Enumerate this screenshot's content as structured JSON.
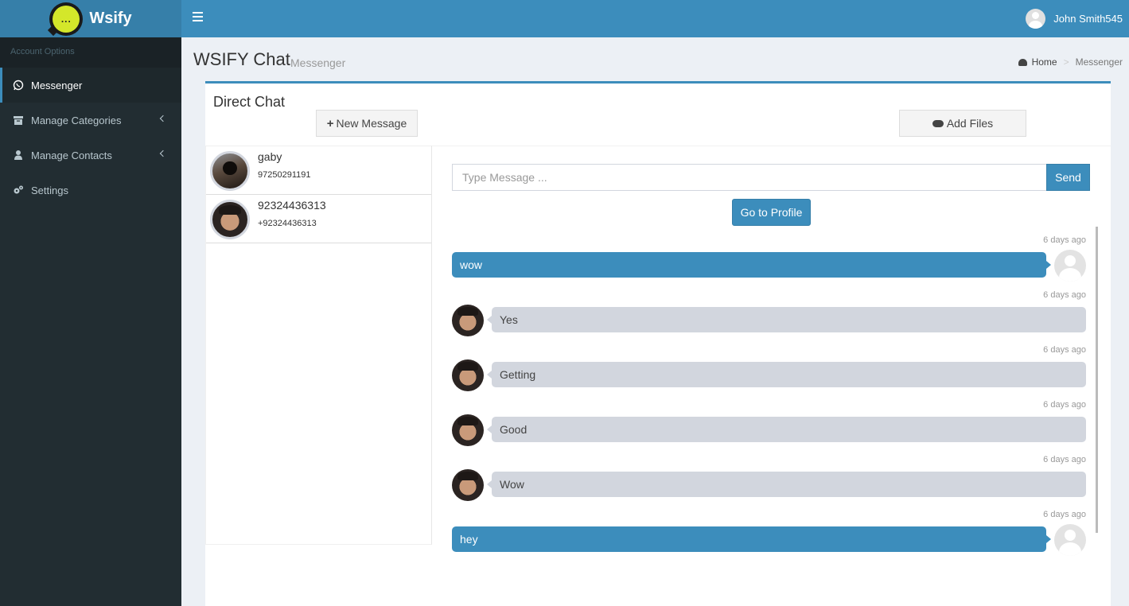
{
  "app": {
    "logo_glyph": "...",
    "logo_text": "Wsify"
  },
  "header": {
    "user_name": "John Smith545"
  },
  "sidebar": {
    "header": "Account Options",
    "items": [
      {
        "label": "Messenger",
        "icon": "whatsapp-icon",
        "active": true
      },
      {
        "label": "Manage Categories",
        "icon": "archive-icon",
        "has_children": true
      },
      {
        "label": "Manage Contacts",
        "icon": "user-icon",
        "has_children": true
      },
      {
        "label": "Settings",
        "icon": "gears-icon"
      }
    ]
  },
  "content": {
    "title": "WSIFY Chat",
    "subtitle": "Messenger",
    "breadcrumb": {
      "home": "Home",
      "current": "Messenger"
    }
  },
  "box": {
    "title": "Direct Chat",
    "new_message_label": "New Message",
    "add_files_label": "Add Files"
  },
  "contacts": [
    {
      "name": "gaby",
      "phone": "97250291191"
    },
    {
      "name": "92324436313",
      "phone": "+92324436313"
    }
  ],
  "chat": {
    "input_placeholder": "Type Message ...",
    "send_label": "Send",
    "profile_label": "Go to Profile",
    "messages": [
      {
        "direction": "out",
        "text": "wow",
        "time": "6 days ago"
      },
      {
        "direction": "in",
        "text": "Yes",
        "time": "6 days ago"
      },
      {
        "direction": "in",
        "text": "Getting",
        "time": "6 days ago"
      },
      {
        "direction": "in",
        "text": "Good",
        "time": "6 days ago"
      },
      {
        "direction": "in",
        "text": "Wow",
        "time": "6 days ago"
      },
      {
        "direction": "out",
        "text": "hey",
        "time": "6 days ago"
      }
    ]
  },
  "colors": {
    "primary": "#3c8dbc",
    "sidebar_bg": "#222d32",
    "logo_accent": "#d4e72a"
  }
}
